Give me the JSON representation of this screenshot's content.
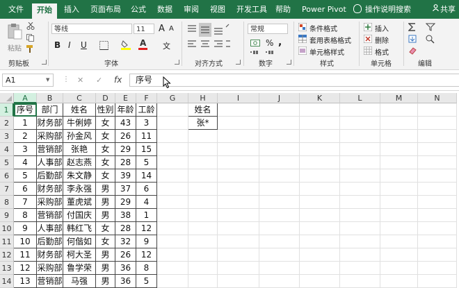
{
  "tabs": [
    "文件",
    "开始",
    "插入",
    "页面布局",
    "公式",
    "数据",
    "审阅",
    "视图",
    "开发工具",
    "帮助",
    "Power Pivot",
    "操作说明搜索",
    "共享"
  ],
  "ribbon": {
    "paste_label": "粘贴",
    "font_name": "等线",
    "font_size": "11",
    "number_format": "常规",
    "conditional_format": "条件格式",
    "table_format": "套用表格格式",
    "cell_style": "单元格样式",
    "insert": "插入",
    "delete": "删除",
    "format": "格式",
    "groups": [
      "剪贴板",
      "字体",
      "对齐方式",
      "数字",
      "样式",
      "单元格",
      "编辑"
    ],
    "font_a_big": "A",
    "font_a_small": "A",
    "wen": "文",
    "percent": "%",
    "comma": ",",
    "bold": "B",
    "italic": "I",
    "underline": "U",
    "font_color_letter": "A"
  },
  "formula_bar": {
    "name_box": "A1",
    "cancel": "✕",
    "enter": "✓",
    "fx": "fx",
    "content": "序号"
  },
  "columns": [
    "A",
    "B",
    "C",
    "D",
    "E",
    "F",
    "G",
    "H",
    "I",
    "J",
    "K",
    "L",
    "M",
    "N"
  ],
  "rows": [
    "1",
    "2",
    "3",
    "4",
    "5",
    "6",
    "7",
    "8",
    "9",
    "10",
    "11",
    "12",
    "13",
    "14"
  ],
  "table": {
    "headers": [
      "序号",
      "部门",
      "姓名",
      "性别",
      "年龄",
      "工龄"
    ],
    "data": [
      [
        "1",
        "财务部",
        "牛俐婷",
        "女",
        "43",
        "3"
      ],
      [
        "2",
        "采购部",
        "孙金风",
        "女",
        "26",
        "11"
      ],
      [
        "3",
        "营销部",
        "张艳",
        "女",
        "29",
        "15"
      ],
      [
        "4",
        "人事部",
        "赵志燕",
        "女",
        "28",
        "5"
      ],
      [
        "5",
        "后勤部",
        "朱文静",
        "女",
        "39",
        "14"
      ],
      [
        "6",
        "财务部",
        "李永强",
        "男",
        "37",
        "6"
      ],
      [
        "7",
        "采购部",
        "董虎斌",
        "男",
        "29",
        "4"
      ],
      [
        "8",
        "营销部",
        "付国庆",
        "男",
        "38",
        "1"
      ],
      [
        "9",
        "人事部",
        "韩红飞",
        "女",
        "28",
        "12"
      ],
      [
        "10",
        "后勤部",
        "何偕如",
        "女",
        "32",
        "9"
      ],
      [
        "11",
        "财务部",
        "柯大圣",
        "男",
        "26",
        "12"
      ],
      [
        "12",
        "采购部",
        "鲁学荣",
        "男",
        "36",
        "8"
      ],
      [
        "13",
        "营销部",
        "马强",
        "男",
        "36",
        "5"
      ]
    ]
  },
  "criteria": {
    "header": "姓名",
    "value": "张*"
  },
  "colors": {
    "excel_green": "#217346",
    "selection_fill": "#d3f0e0",
    "highlight_yellow": "#ffff00",
    "font_red": "#e02020"
  }
}
